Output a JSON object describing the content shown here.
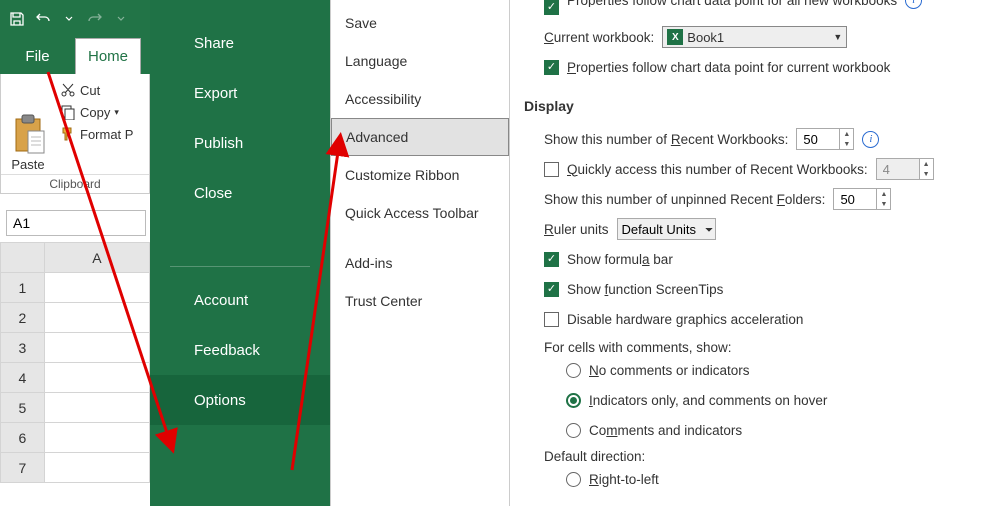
{
  "qat": {},
  "ribbon": {
    "file_tab": "File",
    "home_tab": "Home"
  },
  "clipboard": {
    "paste": "Paste",
    "cut": "Cut",
    "copy": "Copy",
    "format_painter": "Format P",
    "group_label": "Clipboard"
  },
  "namebox": {
    "value": "A1"
  },
  "grid": {
    "col_header": "A",
    "rows": [
      "1",
      "2",
      "3",
      "4",
      "5",
      "6",
      "7"
    ]
  },
  "backstage": {
    "share": "Share",
    "export": "Export",
    "publish": "Publish",
    "close": "Close",
    "account": "Account",
    "feedback": "Feedback",
    "options": "Options"
  },
  "categories": {
    "save": "Save",
    "language": "Language",
    "accessibility": "Accessibility",
    "advanced": "Advanced",
    "customize_ribbon": "Customize Ribbon",
    "qat": "Quick Access Toolbar",
    "addins": "Add-ins",
    "trust_center": "Trust Center"
  },
  "advanced": {
    "current_workbook_label_pre": "C",
    "current_workbook_label_post": "urrent workbook:",
    "workbook_name": "Book1",
    "prop_current_pre": "P",
    "prop_current_post": "roperties follow chart data point for current workbook",
    "display_section": "Display",
    "recent_wb_label_pre": "Show this number of ",
    "recent_wb_label_mid": "R",
    "recent_wb_label_post": "ecent Workbooks:",
    "recent_wb_value": "50",
    "quick_access_pre": "Q",
    "quick_access_post": "uickly access this number of Recent Workbooks:",
    "quick_access_value": "4",
    "recent_folders_label_pre": "Show this number of unpinned Recent ",
    "recent_folders_label_mid": "F",
    "recent_folders_label_post": "olders:",
    "recent_folders_value": "50",
    "ruler_label_pre": "R",
    "ruler_label_post": "uler units",
    "ruler_value": "Default Units",
    "formula_bar_pre": "Show formul",
    "formula_bar_mid": "a",
    "formula_bar_post": " bar",
    "screentips_pre": "Show ",
    "screentips_mid": "f",
    "screentips_post": "unction ScreenTips",
    "hw_accel_pre": "Disable hardware ",
    "hw_accel_mid": "g",
    "hw_accel_post": "raphics acceleration",
    "comments_heading": "For cells with comments, show:",
    "comments_none_pre": "N",
    "comments_none_post": "o comments or indicators",
    "comments_ind_pre": "I",
    "comments_ind_post": "ndicators only, and comments on hover",
    "comments_both_pre": "Co",
    "comments_both_mid": "m",
    "comments_both_post": "ments and indicators",
    "default_dir_heading": "Default direction:",
    "rtl_pre": "R",
    "rtl_post": "ight-to-left"
  }
}
